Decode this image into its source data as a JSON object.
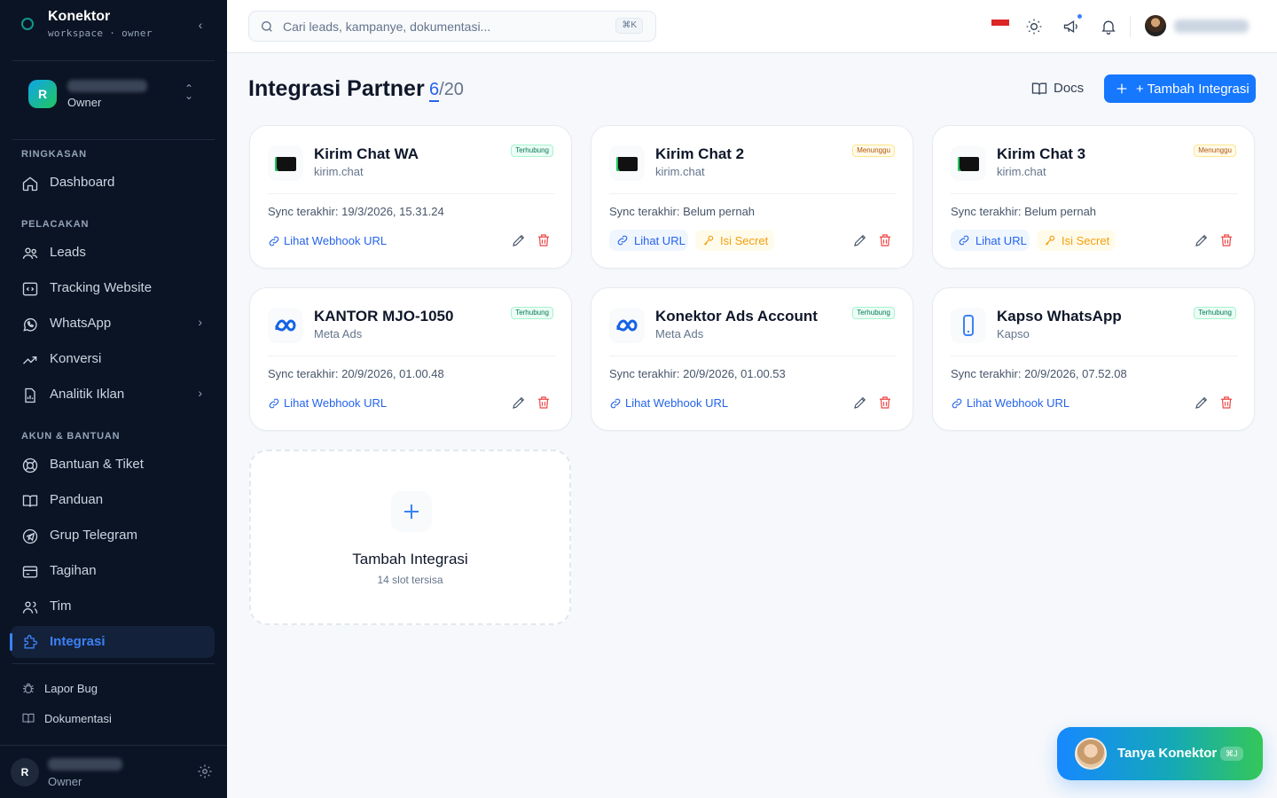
{
  "sidebar": {
    "brand": {
      "name": "Konektor",
      "sub": "workspace · owner"
    },
    "workspace": {
      "avatar_letter": "R",
      "role": "Owner"
    },
    "sections": [
      {
        "title": "RINGKASAN"
      },
      {
        "title": "PELACAKAN"
      },
      {
        "title": "AKUN & BANTUAN"
      }
    ],
    "items": [
      {
        "label": "Dashboard",
        "icon": "home-icon"
      },
      {
        "label": "Leads",
        "icon": "users-icon"
      },
      {
        "label": "Tracking Website",
        "icon": "code-icon"
      },
      {
        "label": "WhatsApp",
        "icon": "whatsapp-icon"
      },
      {
        "label": "Konversi",
        "icon": "trending-icon"
      },
      {
        "label": "Analitik Iklan",
        "icon": "file-chart-icon"
      },
      {
        "label": "Bantuan & Tiket",
        "icon": "lifebuoy-icon"
      },
      {
        "label": "Panduan",
        "icon": "book-icon"
      },
      {
        "label": "Grup Telegram",
        "icon": "telegram-icon"
      },
      {
        "label": "Tagihan",
        "icon": "credit-card-icon"
      },
      {
        "label": "Tim",
        "icon": "team-icon"
      },
      {
        "label": "Integrasi",
        "icon": "puzzle-icon"
      }
    ],
    "footer_links": [
      {
        "label": "Lapor Bug",
        "icon": "bug-icon"
      },
      {
        "label": "Dokumentasi",
        "icon": "book-icon"
      }
    ],
    "user": {
      "avatar_letter": "R",
      "role": "Owner"
    }
  },
  "topbar": {
    "search_placeholder": "Cari leads, kampanye, dokumentasi...",
    "search_shortcut": "⌘K"
  },
  "page": {
    "title": "Integrasi Partner",
    "count_current": "6",
    "count_sep": "/",
    "count_max": "20",
    "docs_label": "Docs",
    "add_label": "+ Tambah Integrasi"
  },
  "cards": [
    {
      "name": "Kirim Chat WA",
      "sub": "kirim.chat",
      "status": "Terhubung",
      "sync": "Sync terakhir: 19/3/2026, 15.31.24",
      "webhook": "Lihat Webhook URL"
    },
    {
      "name": "Kirim Chat 2",
      "sub": "kirim.chat",
      "status": "Menunggu",
      "sync": "Sync terakhir: Belum pernah",
      "url": "Lihat URL",
      "secret": "Isi Secret"
    },
    {
      "name": "Kirim Chat 3",
      "sub": "kirim.chat",
      "status": "Menunggu",
      "sync": "Sync terakhir: Belum pernah",
      "url": "Lihat URL",
      "secret": "Isi Secret"
    },
    {
      "name": "KANTOR MJO-1050",
      "sub": "Meta Ads",
      "status": "Terhubung",
      "sync": "Sync terakhir: 20/9/2026, 01.00.48",
      "webhook": "Lihat Webhook URL"
    },
    {
      "name": "Konektor Ads Account",
      "sub": "Meta Ads",
      "status": "Terhubung",
      "sync": "Sync terakhir: 20/9/2026, 01.00.53",
      "webhook": "Lihat Webhook URL"
    },
    {
      "name": "Kapso WhatsApp",
      "sub": "Kapso",
      "status": "Terhubung",
      "sync": "Sync terakhir: 20/9/2026, 07.52.08",
      "webhook": "Lihat Webhook URL"
    }
  ],
  "add_card": {
    "title": "Tambah Integrasi",
    "sub": "14 slot tersisa"
  },
  "chat": {
    "label": "Tanya Konektor",
    "shortcut": "⌘J"
  },
  "colors": {
    "accent": "#1677ff",
    "sidebar_bg": "#0b1424",
    "connected": "#047857",
    "waiting": "#b45309",
    "danger": "#ef4444"
  }
}
